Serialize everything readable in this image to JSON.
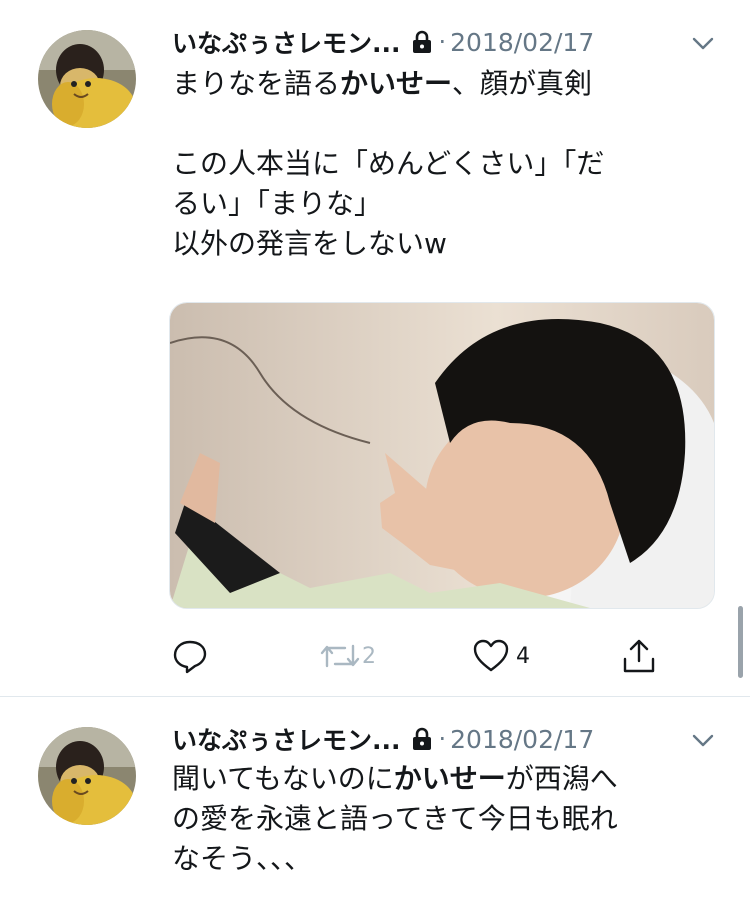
{
  "tweets": [
    {
      "display_name": "いなぷぅさレモン...",
      "date": "2018/02/17",
      "separator": "·",
      "text": {
        "p1_a": "まりなを語る",
        "p1_b": "かいせー",
        "p1_c": "、顔が真剣",
        "p2_l1": "この人本当に「めんどくさい」「だ",
        "p2_l2": "るい」「まりな」",
        "p2_l3": "以外の発言をしないw"
      },
      "retweet_count": "2",
      "like_count": "4"
    },
    {
      "display_name": "いなぷぅさレモン...",
      "date": "2018/02/17",
      "separator": "·",
      "text": {
        "l1_a": "聞いてもないのに",
        "l1_b": "かいせー",
        "l1_c": "が西潟へ",
        "l2": "の愛を永遠と語ってきて今日も眠れ",
        "l3": "なそう、、、"
      }
    }
  ],
  "icons": [
    "lock-icon",
    "chevron-down-icon",
    "reply-icon",
    "retweet-icon",
    "like-icon",
    "share-icon"
  ],
  "colors": {
    "text": "#14171a",
    "secondary": "#657786",
    "divider": "#e1e8ed",
    "disabled": "#aab8c2"
  }
}
